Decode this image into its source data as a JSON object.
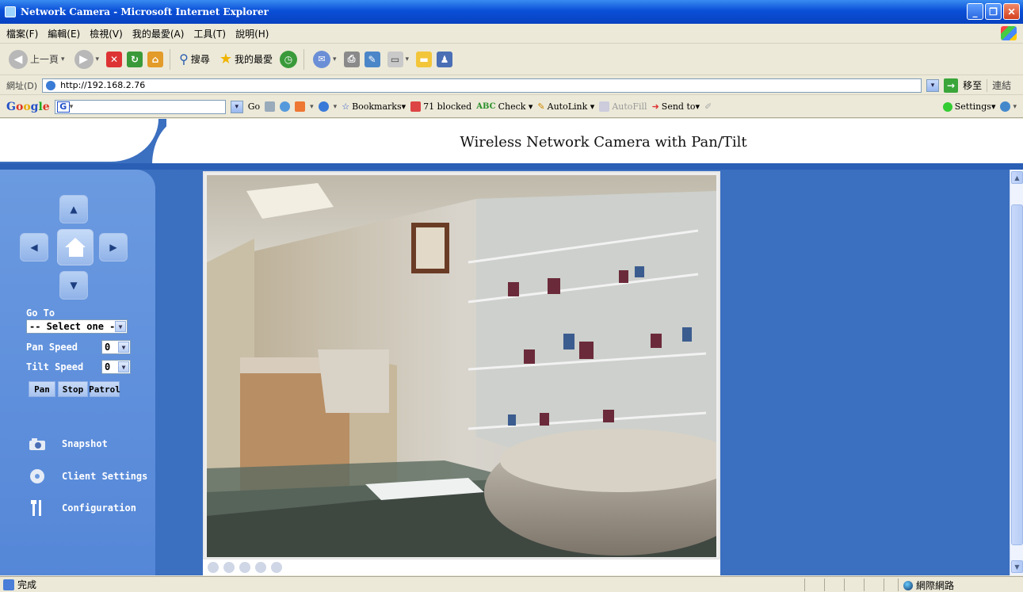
{
  "window": {
    "title": "Network Camera - Microsoft Internet Explorer"
  },
  "menu": [
    "檔案(F)",
    "編輯(E)",
    "檢視(V)",
    "我的最愛(A)",
    "工具(T)",
    "說明(H)"
  ],
  "toolbar": {
    "back_label": "上一頁",
    "search_label": "搜尋",
    "favorites_label": "我的最愛"
  },
  "address": {
    "label": "網址(D)",
    "url": "http://192.168.2.76",
    "go_label": "移至",
    "links_label": "連結"
  },
  "google": {
    "go_label": "Go",
    "bookmarks_label": "Bookmarks▾",
    "blocked_label": "71 blocked",
    "check_label": "Check ▾",
    "autolink_label": "AutoLink ▾",
    "autofill_label": "AutoFill",
    "sendto_label": "Send to▾",
    "settings_label": "Settings▾"
  },
  "page": {
    "title": "Wireless Network Camera with Pan/Tilt"
  },
  "sidebar": {
    "goto_label": "Go To",
    "goto_select": "-- Select one --",
    "pan_speed_label": "Pan Speed",
    "pan_speed_value": "0",
    "tilt_speed_label": "Tilt Speed",
    "tilt_speed_value": "0",
    "buttons": {
      "pan": "Pan",
      "stop": "Stop",
      "patrol": "Patrol"
    },
    "nav": {
      "snapshot": "Snapshot",
      "client_settings": "Client Settings",
      "configuration": "Configuration"
    }
  },
  "status": {
    "text": "完成",
    "zone": "網際網路"
  }
}
